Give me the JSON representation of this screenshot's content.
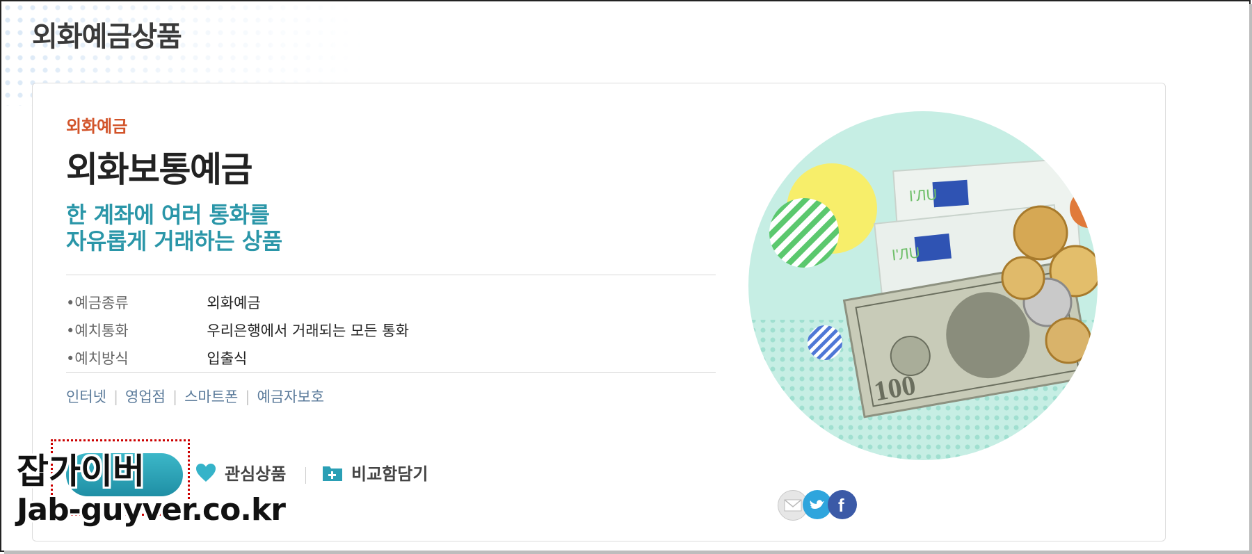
{
  "page": {
    "title": "외화예금상품"
  },
  "product": {
    "category": "외화예금",
    "name": "외화보통예금",
    "tagline_line1": "한 계좌에 여러 통화를",
    "tagline_line2": "자유롭게 거래하는 상품"
  },
  "info": [
    {
      "bullet": "•",
      "label": "예금종류",
      "value": "외화예금"
    },
    {
      "bullet": "•",
      "label": "예치통화",
      "value": "우리은행에서 거래되는 모든 통화"
    },
    {
      "bullet": "•",
      "label": "예치방식",
      "value": "입출식"
    }
  ],
  "channels": [
    "인터넷",
    "영업점",
    "스마트폰",
    "예금자보호"
  ],
  "actions": {
    "interest_label": "관심상품",
    "compare_label": "비교함담기"
  },
  "share": [
    {
      "icon": "mail-icon",
      "color": "#e6e6e6"
    },
    {
      "icon": "twitter-icon",
      "color": "#2ea5dd"
    },
    {
      "icon": "facebook-icon",
      "color": "#3b5aa7"
    }
  ],
  "watermark": {
    "korean": "잡가이버",
    "url": "Jab-guyver.co.kr"
  },
  "colors": {
    "category": "#d2542a",
    "tagline": "#2a96a8",
    "button": "#2aa3b8",
    "heart": "#35b3c9",
    "hero_bg": "#c6eee4"
  }
}
